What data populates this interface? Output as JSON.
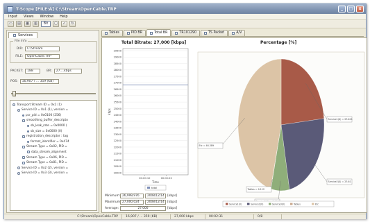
{
  "window": {
    "title": "T-Scope [FILE:A] C:\\Stream\\OpenCable.TRP",
    "buttons": {
      "minimize": "_",
      "maximize": "□",
      "close": "x"
    }
  },
  "menu": [
    "Input",
    "Views",
    "Window",
    "Help"
  ],
  "toolbar": {
    "items": [
      {
        "icon": "open-icon",
        "glyph": "▭"
      },
      {
        "icon": "save-icon",
        "glyph": "▤"
      },
      {
        "icon": "grid-icon",
        "glyph": "▦"
      },
      {
        "icon": "stream-icon",
        "glyph": "▥"
      },
      {
        "icon": "bin-icon",
        "glyph": "Bit"
      },
      {
        "icon": "window-icon",
        "glyph": "▢"
      },
      {
        "icon": "check-icon",
        "glyph": "✓"
      },
      {
        "icon": "refresh-icon",
        "glyph": "↻"
      }
    ]
  },
  "left": {
    "tab": "Services",
    "fileinfo": {
      "legend": "File Info",
      "dir_label": "DIR:",
      "dir": "C:\\Stream",
      "file_label": "FILE:",
      "file": "OpenCable.TRP"
    },
    "packet_label": "PACKET:",
    "packet": "188",
    "br_label": "BR:",
    "br": "27....kbps",
    "pos_label": "POS:",
    "pos": "16,907 / ... 359 (KB)",
    "slider_fraction": 0.02,
    "tree": [
      {
        "depth": 0,
        "icon": "ring",
        "text": "Transport Stream ID = 0x1 (1)"
      },
      {
        "depth": 1,
        "icon": "ring",
        "text": "Service ID = 0x1 (1), version ="
      },
      {
        "depth": 2,
        "icon": "dot",
        "text": "pcr_pid = 0x0100 (256)"
      },
      {
        "depth": 2,
        "icon": "box",
        "text": "smoothing_buffer_descripto"
      },
      {
        "depth": 3,
        "icon": "dot",
        "text": "sb_leak_rate = 0x0000 ("
      },
      {
        "depth": 3,
        "icon": "dot",
        "text": "sb_size = 0x0000 (0)"
      },
      {
        "depth": 2,
        "icon": "box",
        "text": "registration_descriptor : tag"
      },
      {
        "depth": 3,
        "icon": "dot",
        "text": "format_identifier = 0x474"
      },
      {
        "depth": 2,
        "icon": "box",
        "text": "Stream Type = 0x02, PID ="
      },
      {
        "depth": 3,
        "icon": "box",
        "text": "data_stream_alignment"
      },
      {
        "depth": 2,
        "icon": "box",
        "text": "Stream Type = 0x06, PID ="
      },
      {
        "depth": 2,
        "icon": "box",
        "text": "Stream Type = 0x81, PID ="
      },
      {
        "depth": 1,
        "icon": "ring",
        "text": "Service ID = 0x2 (2), version ="
      },
      {
        "depth": 1,
        "icon": "ring",
        "text": "Service ID = 0x3 (3), version ="
      }
    ]
  },
  "tabs": [
    {
      "label": "Tables",
      "icon": "table-icon"
    },
    {
      "label": "PID BR",
      "icon": "chart-icon"
    },
    {
      "label": "Total BR",
      "icon": "chart-icon"
    },
    {
      "label": "TR101290",
      "icon": "check-icon"
    },
    {
      "label": "TS Packet",
      "icon": "packet-icon"
    },
    {
      "label": "A/V",
      "icon": "av-icon"
    }
  ],
  "active_tab": 2,
  "stats": {
    "min_label": "Minimum:",
    "min_value": "26,999,976",
    "min_time": "2008/12/14",
    "max_label": "Maximum:",
    "max_value": "27,000,024",
    "max_time": "2008/12/14",
    "avg_label": "Average:",
    "avg_value": "27,000",
    "unit": "[kbps]"
  },
  "colors": {
    "service1": "#a85a48",
    "service2": "#5a5a78",
    "service3": "#8fae7a",
    "tables": "#c9a98f",
    "etc": "#dcc4a6",
    "total": "#7f8fb8"
  },
  "chart_data": [
    {
      "type": "line",
      "title": "Total Bitrate: 27,000 [kbps]",
      "xlabel": "Time",
      "ylabel": "kbps",
      "yticks": [
        "29500",
        "29000",
        "28500",
        "28000",
        "27500",
        "27000",
        "26500",
        "26000",
        "25500",
        "25000",
        "24500",
        "24000",
        "23500",
        "23000",
        "22500",
        "22000",
        "21500",
        "21000",
        "20500",
        "20000"
      ],
      "ylim": [
        20000,
        29500
      ],
      "xticks": [
        "00:00:10",
        "00:00:20"
      ],
      "series": [
        {
          "name": "total",
          "values": [
            27000,
            27000,
            27000,
            27000,
            27000
          ]
        }
      ],
      "legend": "bottom"
    },
    {
      "type": "pie",
      "title": "Percentage [%]",
      "slices": [
        {
          "name": "Service1(0)",
          "value": 23.611,
          "label": "Service1(0) = 23.611"
        },
        {
          "name": "Service2(0)",
          "value": 23.611,
          "label": "Service2(0) = 23.61"
        },
        {
          "name": "Service3(0)",
          "value": 6.944,
          "label": "Service3(0) = 6.944"
        },
        {
          "name": "Tables",
          "value": 0.112,
          "label": "Tables = 0.112"
        },
        {
          "name": "Etc",
          "value": 46.389,
          "label": "Etc = 46.389"
        }
      ],
      "legend": [
        "Service1(0)",
        "Service2(0)",
        "Service3(0)",
        "Tables",
        "Etc"
      ],
      "legend_position": "bottom"
    }
  ],
  "status": [
    "C:\\Stream\\OpenCable.TRP",
    "16,907 / ... 359 (KB)",
    "27,000 kbps",
    "00:02:31",
    "0/8"
  ]
}
